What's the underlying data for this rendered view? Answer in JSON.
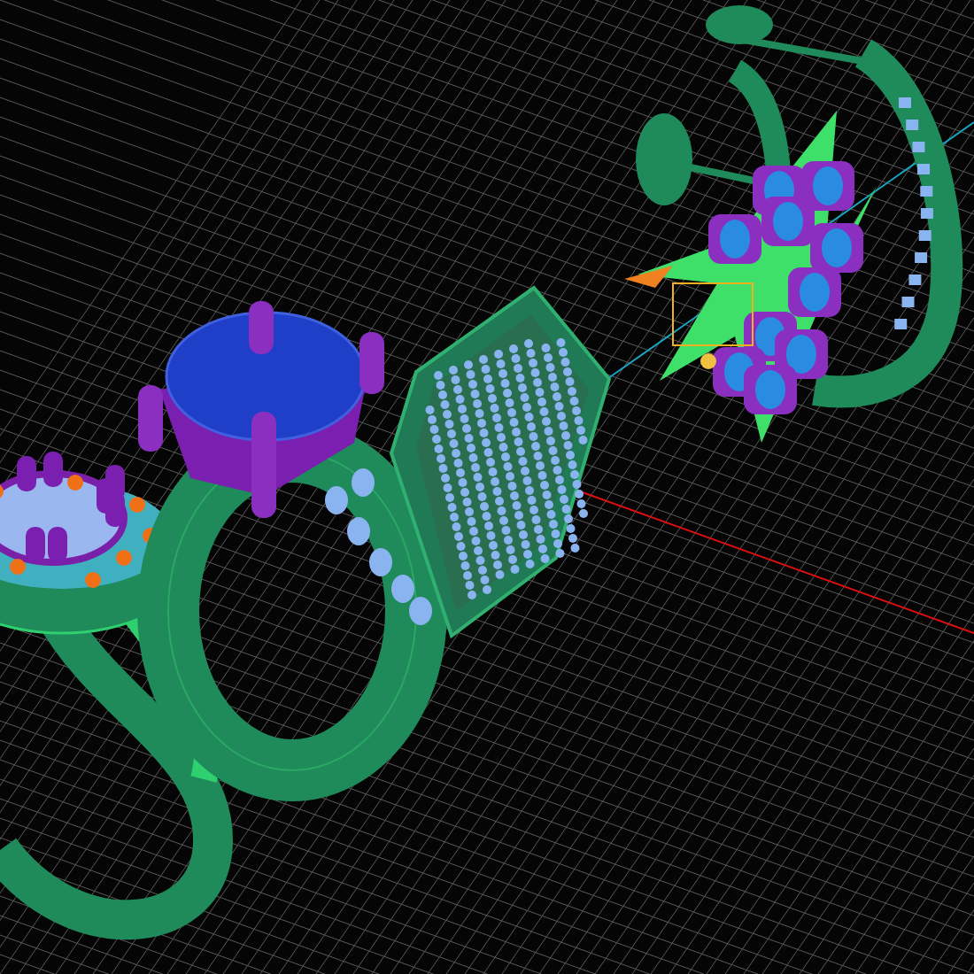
{
  "viewport": {
    "kind": "perspective-grid",
    "objects": [
      {
        "kind": "halo-ring"
      },
      {
        "kind": "solitaire-ring"
      },
      {
        "kind": "pendant"
      },
      {
        "kind": "earring"
      }
    ]
  }
}
